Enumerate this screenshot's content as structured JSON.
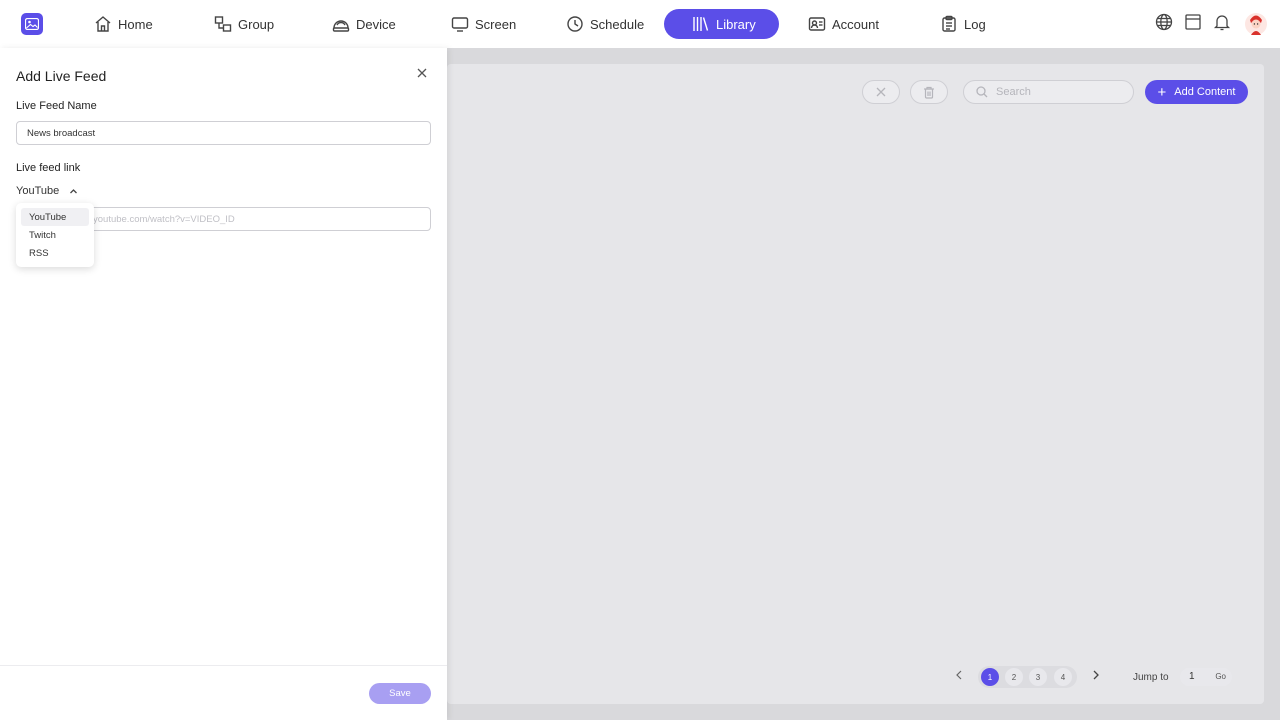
{
  "nav": {
    "items": [
      {
        "label": "Home",
        "icon": "home-icon"
      },
      {
        "label": "Group",
        "icon": "group-icon"
      },
      {
        "label": "Device",
        "icon": "device-icon"
      },
      {
        "label": "Screen",
        "icon": "screen-icon"
      },
      {
        "label": "Schedule",
        "icon": "clock-icon"
      },
      {
        "label": "Library",
        "icon": "library-icon",
        "active": true
      },
      {
        "label": "Account",
        "icon": "account-icon"
      },
      {
        "label": "Log",
        "icon": "log-icon"
      }
    ],
    "accent": "#5b4ee8"
  },
  "toolbar": {
    "search_placeholder": "Search",
    "add_label": "Add Content"
  },
  "pagination": {
    "pages": [
      "1",
      "2",
      "3",
      "4"
    ],
    "current": "1",
    "jump_label": "Jump to",
    "jump_value": "1",
    "go_label": "Go"
  },
  "panel": {
    "title": "Add Live Feed",
    "name_label": "Live Feed Name",
    "name_value": "News broadcast",
    "link_label": "Live feed link",
    "source_selected": "YouTube",
    "source_options": [
      "YouTube",
      "Twitch",
      "RSS"
    ],
    "link_placeholder": "youtube.com/watch?v=VIDEO_ID",
    "save_label": "Save"
  }
}
